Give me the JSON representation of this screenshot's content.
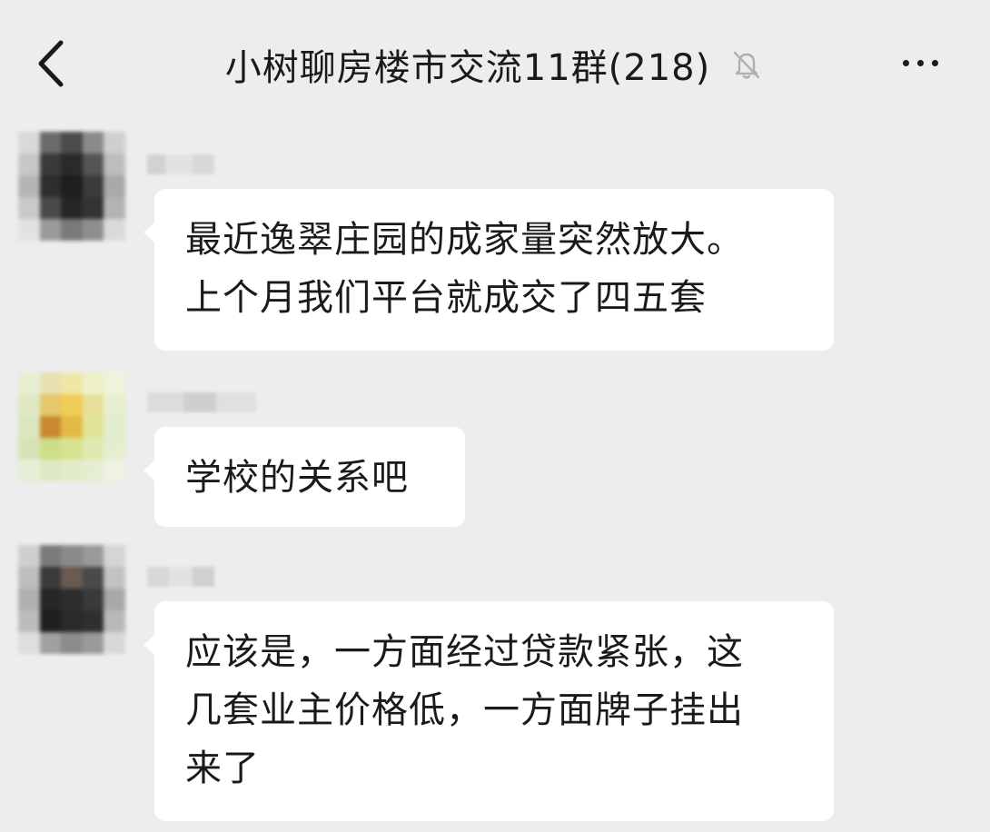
{
  "header": {
    "back_icon": "chevron-left-icon",
    "title": "小树聊房楼市交流11群(218)",
    "mute_icon": "bell-off-icon",
    "more_icon": "more-horizontal-icon"
  },
  "messages": [
    {
      "avatar_colors": [
        "#d9d9d9",
        "#6a6a6a",
        "#4b4b4b",
        "#8a8a8a",
        "#cfcfcf",
        "#c7c7c7",
        "#3a3a3a",
        "#2a2a2a",
        "#555555",
        "#bdbdbd",
        "#b5b5b5",
        "#2e2e2e",
        "#1e1e1e",
        "#3c3c3c",
        "#a9a9a9",
        "#c9c9c9",
        "#4a4a4a",
        "#262626",
        "#333333",
        "#b3b3b3",
        "#e2e2e2",
        "#9a9a9a",
        "#7a7a7a",
        "#8e8e8e",
        "#dadada"
      ],
      "lines": [
        "最近逸翠庄园的成家量突然放大。",
        "上个月我们平台就成交了四五套"
      ]
    },
    {
      "avatar_colors": [
        "#e7eed2",
        "#e8e0b0",
        "#efe6a8",
        "#eef0c9",
        "#eef3dc",
        "#dfe8c4",
        "#e6c86a",
        "#f0cc55",
        "#e8e09a",
        "#e6efcf",
        "#dbe6bd",
        "#c9892e",
        "#e4ba46",
        "#e3e39a",
        "#e2edcb",
        "#d7e3b7",
        "#cddf86",
        "#d8e392",
        "#dfe8b0",
        "#e4edcf",
        "#e6eed7",
        "#dde8c4",
        "#e2ebc9",
        "#e5edd1",
        "#edf2e2"
      ],
      "lines": [
        "学校的关系吧"
      ]
    },
    {
      "avatar_colors": [
        "#cfcfcf",
        "#7a7a7a",
        "#8a8a8a",
        "#9a9a9a",
        "#d5d5d5",
        "#bdbdbd",
        "#3a3a3a",
        "#6a5a50",
        "#4a4a4a",
        "#c2c2c2",
        "#b0b0b0",
        "#262626",
        "#2d2d2d",
        "#3a3a3a",
        "#a8a8a8",
        "#bcbcbc",
        "#1f1f1f",
        "#2a2a2a",
        "#2f2f2f",
        "#b8b8b8",
        "#dedede",
        "#a0a0a0",
        "#8c8c8c",
        "#9a9a9a",
        "#d8d8d8"
      ],
      "lines": [
        "应该是，一方面经过贷款紧张，这",
        "几套业主价格低，一方面牌子挂出",
        "来了"
      ]
    }
  ]
}
